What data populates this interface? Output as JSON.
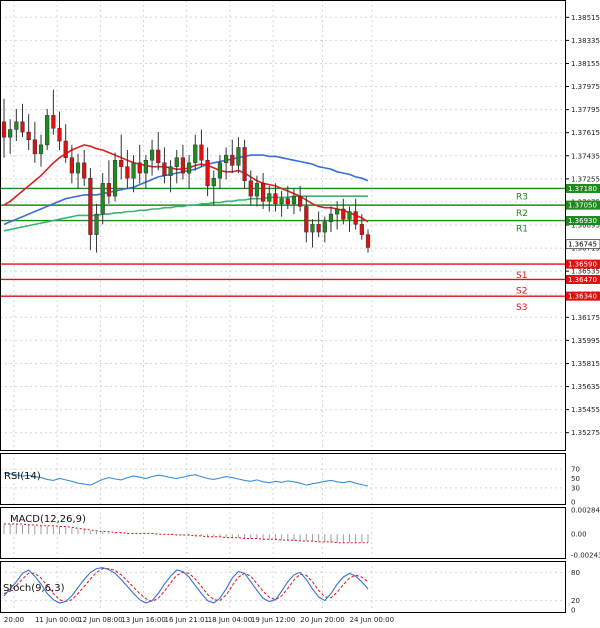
{
  "chart_data": [
    {
      "type": "candlestick",
      "title": "",
      "ylim": [
        1.3514,
        1.3865
      ],
      "y_ticks": [
        "1.38515",
        "1.38335",
        "1.38155",
        "1.37975",
        "1.37795",
        "1.37615",
        "1.37435",
        "1.37255",
        "1.37075",
        "1.36895",
        "1.36715",
        "1.36535",
        "1.36355",
        "1.36175",
        "1.35995",
        "1.35815",
        "1.35635",
        "1.35455",
        "1.35275"
      ],
      "x_ticks": [
        "20:00",
        "11 Jun 00:00",
        "12 Jun 08:00",
        "13 Jun 16:00",
        "16 Jun 21:01",
        "18 Jun 04:00",
        "19 Jun 12:00",
        "20 Jun 20:00",
        "24 Jun 00:00"
      ],
      "candles": [
        [
          1.377,
          1.3788,
          1.3742,
          1.3758
        ],
        [
          1.3758,
          1.3772,
          1.3745,
          1.3764
        ],
        [
          1.3764,
          1.378,
          1.3755,
          1.377
        ],
        [
          1.377,
          1.3784,
          1.3758,
          1.3762
        ],
        [
          1.3762,
          1.3776,
          1.3748,
          1.3756
        ],
        [
          1.3756,
          1.377,
          1.3738,
          1.3745
        ],
        [
          1.3745,
          1.376,
          1.3735,
          1.3752
        ],
        [
          1.3752,
          1.378,
          1.3748,
          1.3775
        ],
        [
          1.3775,
          1.3795,
          1.376,
          1.3765
        ],
        [
          1.3765,
          1.3778,
          1.3748,
          1.3755
        ],
        [
          1.3755,
          1.3768,
          1.3738,
          1.3742
        ],
        [
          1.3742,
          1.3752,
          1.3722,
          1.373
        ],
        [
          1.373,
          1.3745,
          1.3718,
          1.3738
        ],
        [
          1.3738,
          1.3748,
          1.372,
          1.3726
        ],
        [
          1.3726,
          1.3734,
          1.367,
          1.3682
        ],
        [
          1.3682,
          1.3706,
          1.3668,
          1.3698
        ],
        [
          1.3698,
          1.373,
          1.369,
          1.3722
        ],
        [
          1.3722,
          1.374,
          1.3706,
          1.3712
        ],
        [
          1.3712,
          1.3746,
          1.3708,
          1.374
        ],
        [
          1.374,
          1.376,
          1.3725,
          1.3735
        ],
        [
          1.3735,
          1.3748,
          1.3718,
          1.3726
        ],
        [
          1.3726,
          1.3744,
          1.3715,
          1.3738
        ],
        [
          1.3738,
          1.3752,
          1.3722,
          1.373
        ],
        [
          1.373,
          1.3744,
          1.3718,
          1.374
        ],
        [
          1.374,
          1.3756,
          1.3728,
          1.3748
        ],
        [
          1.3748,
          1.3762,
          1.3732,
          1.3738
        ],
        [
          1.3738,
          1.375,
          1.3722,
          1.3728
        ],
        [
          1.3728,
          1.374,
          1.3715,
          1.3735
        ],
        [
          1.3735,
          1.3748,
          1.3722,
          1.3742
        ],
        [
          1.3742,
          1.3752,
          1.3725,
          1.373
        ],
        [
          1.373,
          1.3744,
          1.3718,
          1.3738
        ],
        [
          1.3738,
          1.376,
          1.3732,
          1.3752
        ],
        [
          1.3752,
          1.3764,
          1.3735,
          1.374
        ],
        [
          1.374,
          1.375,
          1.3712,
          1.372
        ],
        [
          1.372,
          1.3732,
          1.3705,
          1.3726
        ],
        [
          1.3726,
          1.3744,
          1.3718,
          1.3738
        ],
        [
          1.3738,
          1.375,
          1.3725,
          1.3744
        ],
        [
          1.3744,
          1.3756,
          1.373,
          1.3736
        ],
        [
          1.3736,
          1.3758,
          1.373,
          1.375
        ],
        [
          1.375,
          1.3756,
          1.3718,
          1.3724
        ],
        [
          1.3724,
          1.3732,
          1.3705,
          1.3712
        ],
        [
          1.3712,
          1.3728,
          1.3704,
          1.3722
        ],
        [
          1.3722,
          1.373,
          1.3702,
          1.3708
        ],
        [
          1.3708,
          1.372,
          1.37,
          1.3714
        ],
        [
          1.3714,
          1.3722,
          1.37,
          1.3706
        ],
        [
          1.3706,
          1.3716,
          1.3696,
          1.371
        ],
        [
          1.371,
          1.372,
          1.3702,
          1.3706
        ],
        [
          1.3706,
          1.3718,
          1.3698,
          1.3712
        ],
        [
          1.3712,
          1.372,
          1.37,
          1.3704
        ],
        [
          1.3704,
          1.3712,
          1.3676,
          1.3684
        ],
        [
          1.3684,
          1.3694,
          1.3672,
          1.369
        ],
        [
          1.369,
          1.37,
          1.368,
          1.3684
        ],
        [
          1.3684,
          1.3696,
          1.3676,
          1.3692
        ],
        [
          1.3692,
          1.3704,
          1.3684,
          1.3698
        ],
        [
          1.3698,
          1.3708,
          1.3686,
          1.3702
        ],
        [
          1.3702,
          1.371,
          1.369,
          1.3694
        ],
        [
          1.3694,
          1.3704,
          1.3684,
          1.37
        ],
        [
          1.37,
          1.371,
          1.3686,
          1.369
        ],
        [
          1.369,
          1.3698,
          1.3678,
          1.3682
        ],
        [
          1.3682,
          1.3686,
          1.3668,
          1.3672
        ]
      ],
      "moving_averages": {
        "red": [
          1.3705,
          1.3708,
          1.3712,
          1.3716,
          1.372,
          1.3724,
          1.3728,
          1.3733,
          1.3738,
          1.3742,
          1.3745,
          1.3748,
          1.375,
          1.3752,
          1.3751,
          1.3749,
          1.3748,
          1.3746,
          1.3744,
          1.3742,
          1.374,
          1.3738,
          1.3737,
          1.3736,
          1.3735,
          1.3735,
          1.3735,
          1.3734,
          1.3733,
          1.3733,
          1.3734,
          1.3736,
          1.3737,
          1.3736,
          1.3734,
          1.3732,
          1.3731,
          1.3731,
          1.3732,
          1.373,
          1.3727,
          1.3724,
          1.3722,
          1.3721,
          1.372,
          1.3718,
          1.3716,
          1.3714,
          1.3712,
          1.3709,
          1.3706,
          1.3704,
          1.3703,
          1.3703,
          1.3702,
          1.3701,
          1.3699,
          1.3697,
          1.3695,
          1.3692
        ],
        "blue": [
          1.369,
          1.3692,
          1.3694,
          1.3696,
          1.3698,
          1.37,
          1.3702,
          1.3704,
          1.3706,
          1.3708,
          1.371,
          1.3711,
          1.3712,
          1.3713,
          1.3713,
          1.3713,
          1.3714,
          1.3715,
          1.3716,
          1.3717,
          1.3718,
          1.3719,
          1.3721,
          1.3723,
          1.3725,
          1.3727,
          1.3728,
          1.3729,
          1.373,
          1.3731,
          1.3732,
          1.3733,
          1.3735,
          1.3737,
          1.3738,
          1.3739,
          1.374,
          1.3741,
          1.3742,
          1.3743,
          1.3744,
          1.3744,
          1.3744,
          1.3743,
          1.3743,
          1.3742,
          1.3741,
          1.374,
          1.3739,
          1.3738,
          1.3737,
          1.3735,
          1.3734,
          1.3733,
          1.3731,
          1.373,
          1.3729,
          1.3727,
          1.3726,
          1.3724
        ],
        "green": [
          1.3685,
          1.3686,
          1.3687,
          1.3688,
          1.3689,
          1.369,
          1.3691,
          1.3692,
          1.3693,
          1.3694,
          1.3695,
          1.3696,
          1.3697,
          1.3697,
          1.3697,
          1.3697,
          1.3698,
          1.3698,
          1.3699,
          1.3699,
          1.37,
          1.37,
          1.3701,
          1.3701,
          1.3702,
          1.3702,
          1.3703,
          1.3703,
          1.3704,
          1.3704,
          1.3705,
          1.3705,
          1.3706,
          1.3706,
          1.3707,
          1.3707,
          1.3708,
          1.3708,
          1.3709,
          1.3709,
          1.371,
          1.371,
          1.371,
          1.3711,
          1.3711,
          1.3711,
          1.3711,
          1.3712,
          1.3712,
          1.3712,
          1.3712,
          1.3712,
          1.3712,
          1.3712,
          1.3712,
          1.3712,
          1.3712,
          1.3712,
          1.3712,
          1.3712
        ]
      },
      "levels": [
        {
          "name": "R3",
          "value": 1.3718,
          "label": "1.37180",
          "color": "#1f8b1f"
        },
        {
          "name": "R2",
          "value": 1.3705,
          "label": "1.37050",
          "color": "#1f8b1f"
        },
        {
          "name": "R1",
          "value": 1.3693,
          "label": "1.36930",
          "color": "#1f8b1f"
        },
        {
          "name": "S1",
          "value": 1.3659,
          "label": "1.36590",
          "color": "#e01010"
        },
        {
          "name": "S2",
          "value": 1.3647,
          "label": "1.36470",
          "color": "#e01010"
        },
        {
          "name": "S3",
          "value": 1.3634,
          "label": "1.36340",
          "color": "#e01010"
        }
      ],
      "current_price": {
        "value": 1.36745,
        "label": "1.36745"
      },
      "colors": {
        "bull": "#1f8b1f",
        "bear": "#e01010",
        "ma_red": "#e02020",
        "ma_blue": "#3a6fd8",
        "ma_green": "#3cb371"
      }
    },
    {
      "type": "line",
      "label": "RSI(14)",
      "ylim": [
        0,
        100
      ],
      "y_ticks": [
        "70",
        "50",
        "30",
        "0"
      ],
      "guides": [
        70,
        30
      ],
      "values": [
        62,
        60,
        58,
        55,
        57,
        54,
        52,
        48,
        46,
        50,
        47,
        44,
        40,
        38,
        36,
        42,
        48,
        52,
        49,
        47,
        52,
        55,
        53,
        50,
        54,
        57,
        55,
        52,
        50,
        53,
        56,
        58,
        54,
        50,
        48,
        51,
        54,
        52,
        49,
        46,
        44,
        47,
        43,
        41,
        44,
        42,
        45,
        43,
        40,
        36,
        39,
        41,
        44,
        46,
        43,
        41,
        44,
        40,
        37,
        34
      ]
    },
    {
      "type": "bar",
      "label": "MACD(12,26,9)",
      "ylim": [
        -0.0028,
        0.0032
      ],
      "y_ticks": [
        "0.002844",
        "0.00",
        "-0.002432"
      ],
      "histogram": [
        0.0012,
        0.0012,
        0.0012,
        0.0011,
        0.0011,
        0.001,
        0.001,
        0.001,
        0.0009,
        0.0009,
        0.0008,
        0.0007,
        0.0006,
        0.0006,
        0.0004,
        0.0003,
        0.0003,
        0.0002,
        0.0002,
        0.0002,
        0.0001,
        0.0001,
        0.0001,
        0.0001,
        0.0,
        0.0,
        0.0,
        -0.0001,
        -0.0001,
        -0.0001,
        -0.0002,
        -0.0002,
        -0.0002,
        -0.0003,
        -0.0003,
        -0.0003,
        -0.0004,
        -0.0004,
        -0.0004,
        -0.0005,
        -0.0005,
        -0.0005,
        -0.0006,
        -0.0006,
        -0.0007,
        -0.0007,
        -0.0007,
        -0.0008,
        -0.0008,
        -0.0008,
        -0.0009,
        -0.0009,
        -0.0009,
        -0.001,
        -0.001,
        -0.001,
        -0.001,
        -0.001,
        -0.001,
        -0.001
      ],
      "signal": [
        0.0012,
        0.0012,
        0.0012,
        0.0012,
        0.0011,
        0.0011,
        0.001,
        0.001,
        0.001,
        0.0009,
        0.0009,
        0.0008,
        0.0007,
        0.0006,
        0.0005,
        0.0004,
        0.0003,
        0.0003,
        0.0002,
        0.0002,
        0.0001,
        0.0001,
        0.0001,
        0.0001,
        0.0001,
        0.0,
        0.0,
        0.0,
        -0.0001,
        -0.0001,
        -0.0001,
        -0.0002,
        -0.0002,
        -0.0003,
        -0.0003,
        -0.0003,
        -0.0004,
        -0.0004,
        -0.0004,
        -0.0005,
        -0.0005,
        -0.0005,
        -0.0006,
        -0.0006,
        -0.0006,
        -0.0007,
        -0.0007,
        -0.0007,
        -0.0008,
        -0.0008,
        -0.0008,
        -0.0009,
        -0.0009,
        -0.0009,
        -0.001,
        -0.001,
        -0.001,
        -0.001,
        -0.001,
        -0.001
      ]
    },
    {
      "type": "line",
      "label": "Stoch(9,6,3)",
      "ylim": [
        0,
        100
      ],
      "y_ticks": [
        "80",
        "20",
        "0"
      ],
      "guides": [
        80,
        20
      ],
      "k": [
        30,
        45,
        60,
        78,
        85,
        72,
        55,
        35,
        22,
        15,
        18,
        30,
        48,
        65,
        80,
        88,
        90,
        86,
        78,
        65,
        50,
        35,
        22,
        15,
        20,
        35,
        55,
        72,
        85,
        82,
        70,
        52,
        35,
        20,
        15,
        25,
        45,
        68,
        82,
        78,
        60,
        42,
        25,
        18,
        22,
        40,
        60,
        75,
        80,
        65,
        45,
        28,
        20,
        35,
        55,
        70,
        78,
        72,
        60,
        45
      ],
      "d": [
        35,
        40,
        52,
        66,
        78,
        78,
        68,
        52,
        35,
        22,
        18,
        22,
        35,
        50,
        66,
        80,
        88,
        88,
        84,
        75,
        62,
        48,
        35,
        24,
        18,
        25,
        40,
        58,
        74,
        80,
        78,
        66,
        50,
        33,
        22,
        20,
        32,
        52,
        70,
        78,
        72,
        56,
        40,
        27,
        22,
        30,
        46,
        64,
        76,
        74,
        60,
        42,
        28,
        26,
        38,
        54,
        68,
        74,
        70,
        60
      ],
      "colors": {
        "k": "#3a6fd8",
        "d": "#e01010"
      }
    }
  ]
}
